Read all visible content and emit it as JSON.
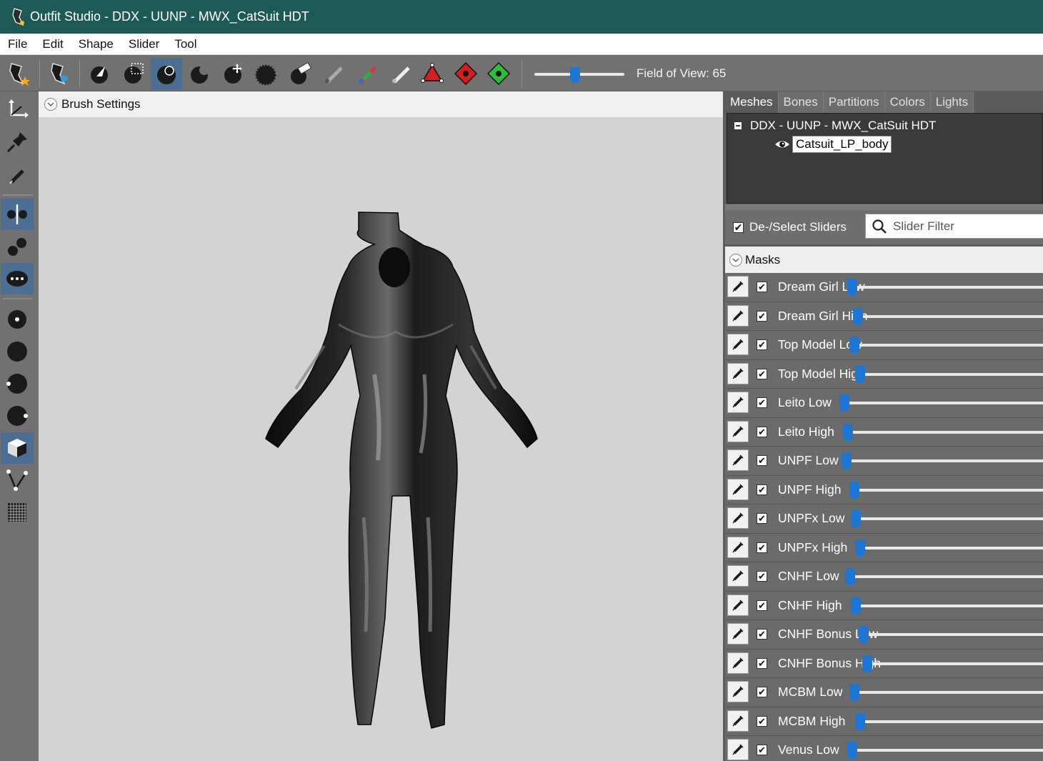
{
  "window": {
    "title": "Outfit Studio - DDX - UUNP - MWX_CatSuit HDT",
    "title_bar_color": "#1e5a55"
  },
  "menu": [
    "File",
    "Edit",
    "Shape",
    "Slider",
    "Tool"
  ],
  "toolbar": {
    "field_of_view_label": "Field of View: 65",
    "field_of_view_slider_value": 65,
    "tools": [
      "logo-star-icon",
      "logo-wave-icon",
      "select-brush-icon",
      "box-select-icon",
      "inflate-brush-icon",
      "deflate-brush-icon",
      "move-brush-icon",
      "smooth-brush-icon",
      "eraser-brush-icon",
      "pencil-brush-icon",
      "color-brush-icon",
      "alpha-brush-icon",
      "transform-gizmo-icon",
      "pivot-icon",
      "center-pivot-icon"
    ],
    "active_tool": "inflate-brush-icon"
  },
  "left_toolbar": [
    "transform-icon",
    "pin-icon",
    "edit-brush-icon",
    "mirror-x-icon",
    "weld-vertices-icon",
    "show-vertices-icon",
    "point-icon",
    "sphere-icon",
    "sphere-left-icon",
    "sphere-right-icon",
    "cube-icon",
    "edge-icon",
    "grid-icon"
  ],
  "brush_settings": {
    "label": "Brush Settings"
  },
  "tabs": [
    "Meshes",
    "Bones",
    "Partitions",
    "Colors",
    "Lights"
  ],
  "active_tab": "Meshes",
  "mesh_tree": {
    "root": "DDX - UUNP - MWX_CatSuit HDT",
    "children": [
      "Catsuit_LP_body"
    ]
  },
  "slider_panel": {
    "deselect_label": "De-/Select Sliders",
    "deselect_checked": true,
    "filter_placeholder": "Slider Filter",
    "masks_label": "Masks"
  },
  "sliders": [
    {
      "name": "Dream Girl Low",
      "checked": true,
      "value": 0.04
    },
    {
      "name": "Dream Girl High",
      "checked": true,
      "value": 0.07
    },
    {
      "name": "Top Model Low",
      "checked": true,
      "value": 0.05
    },
    {
      "name": "Top Model High",
      "checked": true,
      "value": 0.08
    },
    {
      "name": "Leito Low",
      "checked": true,
      "value": 0
    },
    {
      "name": "Leito High",
      "checked": true,
      "value": 0.02
    },
    {
      "name": "UNPF Low",
      "checked": true,
      "value": 0.01
    },
    {
      "name": "UNPF High",
      "checked": true,
      "value": 0.05
    },
    {
      "name": "UNPFx Low",
      "checked": true,
      "value": 0.06
    },
    {
      "name": "UNPFx High",
      "checked": true,
      "value": 0.08
    },
    {
      "name": "CNHF Low",
      "checked": true,
      "value": 0.03
    },
    {
      "name": "CNHF High",
      "checked": true,
      "value": 0.06
    },
    {
      "name": "CNHF Bonus Low",
      "checked": true,
      "value": 0.1
    },
    {
      "name": "CNHF Bonus High",
      "checked": true,
      "value": 0.12
    },
    {
      "name": "MCBM Low",
      "checked": true,
      "value": 0.05
    },
    {
      "name": "MCBM High",
      "checked": true,
      "value": 0.08
    },
    {
      "name": "Venus Low",
      "checked": true,
      "value": 0.04
    }
  ],
  "colors": {
    "accent": "#1e76d2",
    "active_tool_bg": "#4d6e93",
    "viewport_bg": "#d3d3d3"
  }
}
